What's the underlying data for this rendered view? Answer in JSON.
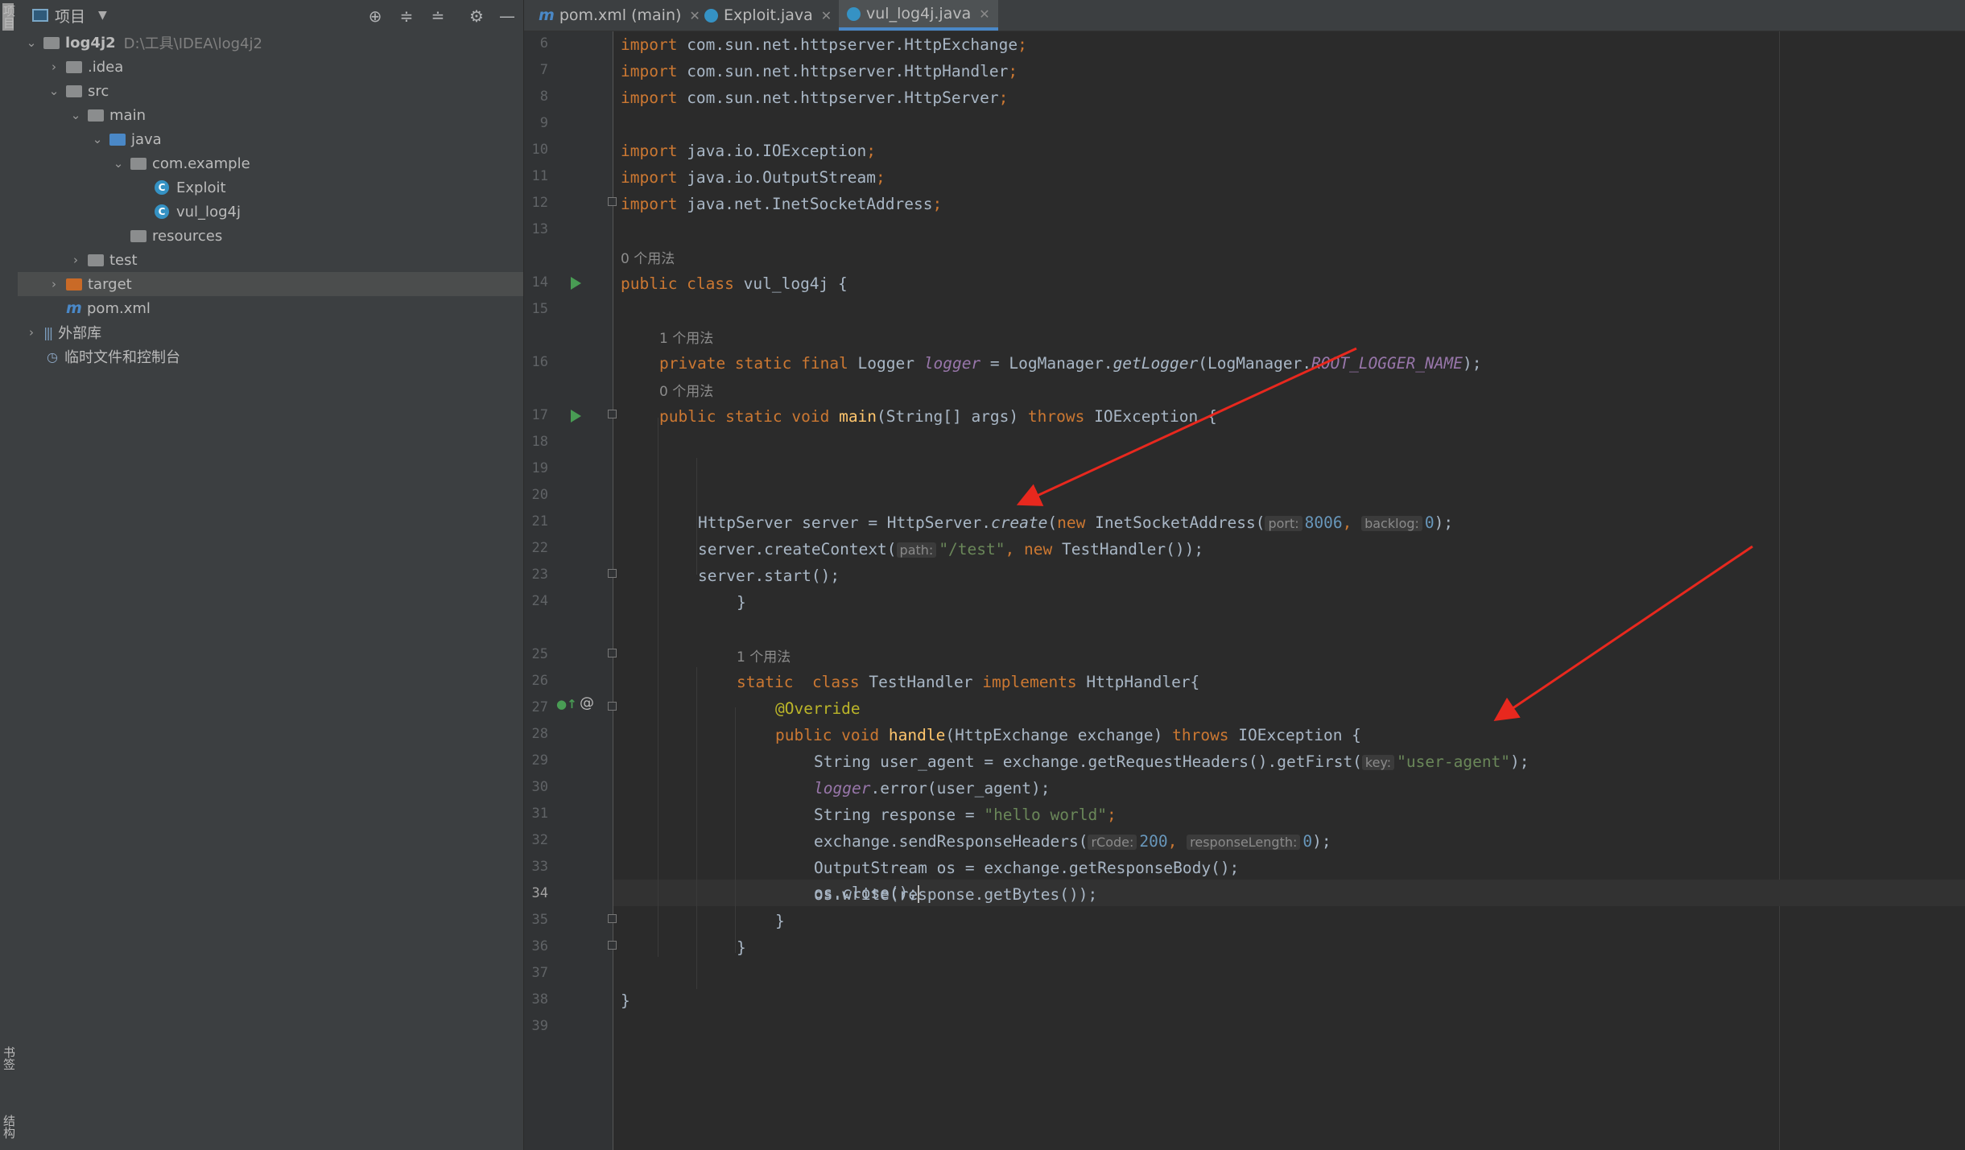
{
  "side_strip": {
    "top_label": "项目",
    "bottom_labels": [
      "书签",
      "结构"
    ]
  },
  "project_panel": {
    "title": "项目",
    "tree": [
      {
        "name": "log4j2",
        "path": "D:\\工具\\IDEA\\log4j2",
        "depth": 0,
        "expanded": true,
        "icon": "module-folder-icon"
      },
      {
        "name": ".idea",
        "depth": 1,
        "expanded": false,
        "icon": "folder-icon"
      },
      {
        "name": "src",
        "depth": 1,
        "expanded": true,
        "icon": "folder-icon"
      },
      {
        "name": "main",
        "depth": 2,
        "expanded": true,
        "icon": "folder-icon"
      },
      {
        "name": "java",
        "depth": 3,
        "expanded": true,
        "icon": "source-folder-icon"
      },
      {
        "name": "com.example",
        "depth": 4,
        "expanded": true,
        "icon": "package-icon"
      },
      {
        "name": "Exploit",
        "depth": 5,
        "icon": "java-class-icon"
      },
      {
        "name": "vul_log4j",
        "depth": 5,
        "icon": "java-class-icon"
      },
      {
        "name": "resources",
        "depth": 4,
        "icon": "resources-folder-icon"
      },
      {
        "name": "test",
        "depth": 2,
        "expanded": false,
        "icon": "folder-icon"
      },
      {
        "name": "target",
        "depth": 1,
        "expanded": false,
        "icon": "excluded-folder-icon",
        "selected": true
      },
      {
        "name": "pom.xml",
        "depth": 1,
        "icon": "maven-icon"
      },
      {
        "name": "外部库",
        "depth": 0,
        "expanded": false,
        "icon": "library-icon"
      },
      {
        "name": "临时文件和控制台",
        "depth": 0,
        "icon": "scratch-icon"
      }
    ]
  },
  "tabs": [
    {
      "label": "pom.xml (main)",
      "icon": "maven-icon",
      "active": false
    },
    {
      "label": "Exploit.java",
      "icon": "java-class-icon",
      "active": false
    },
    {
      "label": "vul_log4j.java",
      "icon": "java-class-icon",
      "active": true
    }
  ],
  "editor": {
    "line_numbers": [
      "6",
      "7",
      "8",
      "9",
      "10",
      "11",
      "12",
      "13",
      "14",
      "15",
      "16",
      "17",
      "18",
      "19",
      "20",
      "21",
      "22",
      "23",
      "24",
      "25",
      "26",
      "27",
      "28",
      "29",
      "30",
      "31",
      "32",
      "33",
      "34",
      "35",
      "36",
      "37",
      "38",
      "39"
    ],
    "current_line": "34",
    "usage_notes": {
      "u13": "0 个用法",
      "u15": "1 个用法",
      "u16": "0 个用法",
      "u24": "1 个用法"
    },
    "code": {
      "l6": [
        "import",
        " com.sun.net.httpserver.HttpExchange",
        ";"
      ],
      "l7": [
        "import",
        " com.sun.net.httpserver.HttpHandler",
        ";"
      ],
      "l8": [
        "import",
        " com.sun.net.httpserver.HttpServer",
        ";"
      ],
      "l10": [
        "import",
        " java.io.IOException",
        ";"
      ],
      "l11": [
        "import",
        " java.io.OutputStream",
        ";"
      ],
      "l12": [
        "import",
        " java.net.InetSocketAddress",
        ";"
      ],
      "l14": [
        "public class",
        " vul_log4j {"
      ],
      "l16": [
        "private static final",
        " Logger ",
        "logger",
        " = LogManager.",
        "getLogger",
        "(LogManager.",
        "ROOT_LOGGER_NAME",
        ");"
      ],
      "l17": [
        "public static void",
        " ",
        "main",
        "(String[] args) ",
        "throws",
        " IOException {"
      ],
      "l20": [
        "HttpServer server = HttpServer.",
        "create",
        "(",
        "new",
        " InetSocketAddress(",
        "port:",
        "8006",
        ", ",
        "backlog:",
        "0",
        ");"
      ],
      "l21": [
        "server.createContext(",
        "path:",
        "\"/test\"",
        ", ",
        "new",
        " TestHandler());"
      ],
      "l22": [
        "server.start();"
      ],
      "l23": [
        "}"
      ],
      "l25": [
        "static",
        "  ",
        "class",
        " TestHandler ",
        "implements",
        " HttpHandler{"
      ],
      "l26": [
        "@Override"
      ],
      "l27": [
        "public void",
        " ",
        "handle",
        "(HttpExchange exchange) ",
        "throws",
        " IOException {"
      ],
      "l28": [
        "String user_agent = exchange.getRequestHeaders().getFirst(",
        "key:",
        "\"user-agent\"",
        ");"
      ],
      "l29": [
        "logger",
        ".error(user_agent);"
      ],
      "l30": [
        "String response = ",
        "\"hello world\"",
        ";"
      ],
      "l31": [
        "exchange.sendResponseHeaders(",
        "rCode:",
        "200",
        ", ",
        "responseLength:",
        "0",
        ");"
      ],
      "l32": [
        "OutputStream os = exchange.getResponseBody();"
      ],
      "l33": [
        "os.write(response.getBytes());"
      ],
      "l34": [
        "os.close();"
      ],
      "l35": [
        "}"
      ],
      "l36": [
        "}"
      ],
      "l38": [
        "}"
      ]
    }
  },
  "colors": {
    "keyword": "#cc7832",
    "method": "#ffc66d",
    "string": "#6a8759",
    "number": "#6897bb",
    "field": "#9876aa",
    "annotation": "#bbb529",
    "arrow": "#e8281e"
  }
}
